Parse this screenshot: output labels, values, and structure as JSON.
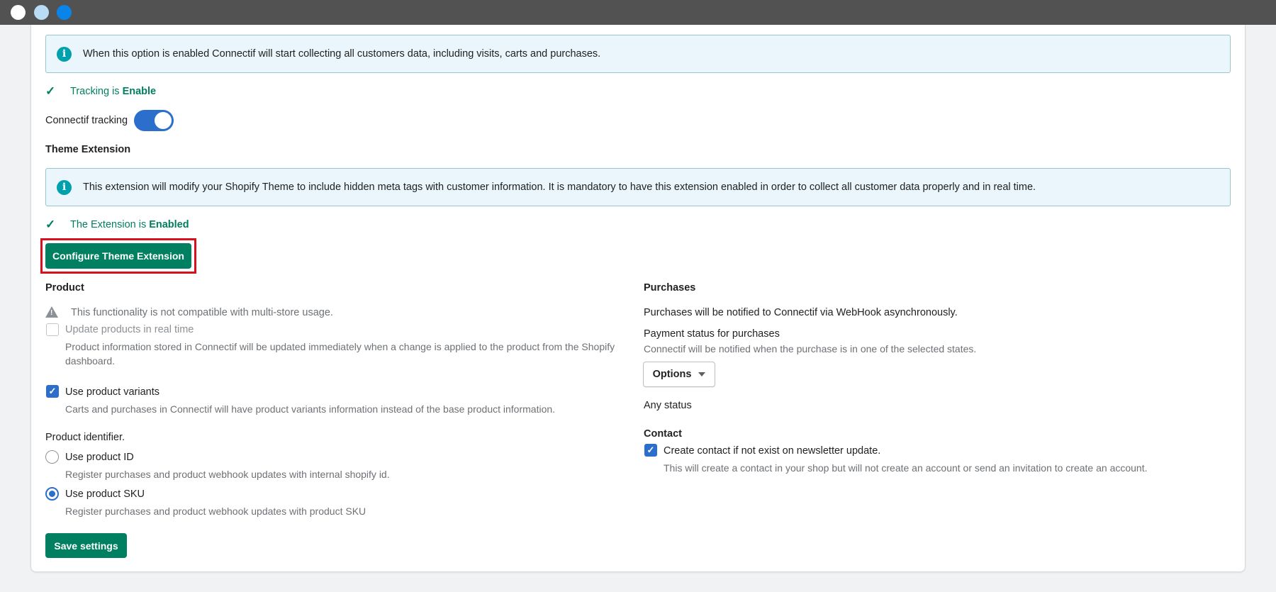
{
  "banners": {
    "tracking_info": "When this option is enabled Connectif will start collecting all customers data, including visits, carts and purchases.",
    "theme_info": "This extension will modify your Shopify Theme to include hidden meta tags with customer information. It is mandatory to have this extension enabled in order to collect all customer data properly and in real time."
  },
  "tracking": {
    "status_prefix": "Tracking is",
    "status_value": "Enable",
    "toggle_label": "Connectif tracking",
    "toggle_on": true
  },
  "theme_extension": {
    "heading": "Theme Extension",
    "status_prefix": "The Extension is",
    "status_value": "Enabled",
    "configure_button": "Configure Theme Extension"
  },
  "product": {
    "heading": "Product",
    "warning": "This functionality is not compatible with multi-store usage.",
    "realtime_label": "Update products in real time",
    "realtime_checked": false,
    "realtime_help_line1": "Product information stored in Connectif will be updated immediately when a change is applied to the product from the Shopify",
    "realtime_help_line2": "dashboard.",
    "variants_label": "Use product variants",
    "variants_checked": true,
    "variants_help": "Carts and purchases in Connectif will have product variants information instead of the base product information.",
    "identifier_label": "Product identifier.",
    "id_option": "Use product ID",
    "id_help": "Register purchases and product webhook updates with internal shopify id.",
    "sku_option": "Use product SKU",
    "sku_help": "Register purchases and product webhook updates with product SKU",
    "selected_identifier": "sku"
  },
  "purchases": {
    "heading": "Purchases",
    "description": "Purchases will be notified to Connectif via WebHook asynchronously.",
    "payment_status_label": "Payment status for purchases",
    "payment_status_help": "Connectif will be notified when the purchase is in one of the selected states.",
    "options_button": "Options",
    "selected_status": "Any status"
  },
  "contact": {
    "heading": "Contact",
    "create_label": "Create contact if not exist on newsletter update.",
    "create_checked": true,
    "create_help": "This will create a contact in your shop but will not create an account or send an invitation to create an account."
  },
  "save_button": "Save settings",
  "colors": {
    "primary": "#008060",
    "accent_blue": "#2c6ecb",
    "info_teal": "#00a0ac",
    "highlight_red": "#d9101e"
  }
}
